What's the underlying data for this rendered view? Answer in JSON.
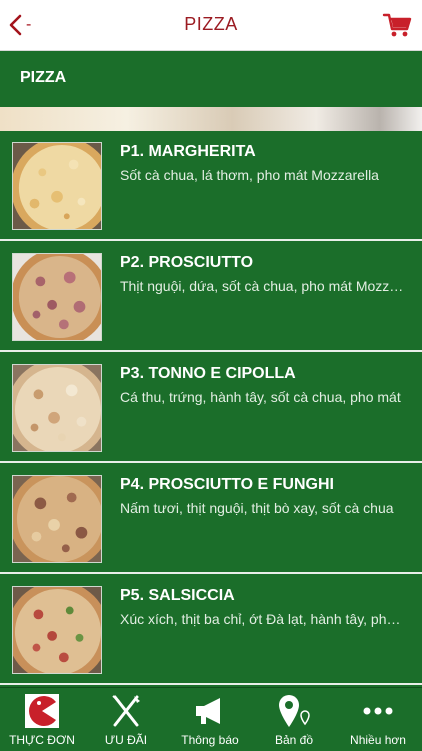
{
  "navbar": {
    "back_label": "-",
    "title": "PIZZA",
    "cart_icon": "cart-icon"
  },
  "section": {
    "title": "PIZZA"
  },
  "items": [
    {
      "title": "P1. MARGHERITA",
      "description": "Sốt cà chua, lá thơm, pho mát Mozzarella"
    },
    {
      "title": "P2. PROSCIUTTO",
      "description": "Thịt nguội, dứa, sốt cà chua, pho mát Mozzarella"
    },
    {
      "title": "P3. TONNO E CIPOLLA",
      "description": "Cá thu, trứng, hành tây, sốt cà chua, pho mát"
    },
    {
      "title": "P4. PROSCIUTTO E FUNGHI",
      "description": "Nấm tươi, thịt nguội, thịt bò xay, sốt cà chua"
    },
    {
      "title": "P5. SALSICCIA",
      "description": "Xúc xích, thịt ba chỉ, ớt Đà lạt, hành tây, pho mát"
    }
  ],
  "tabs": [
    {
      "label": "THỰC ĐƠN",
      "icon": "menu-pacman-icon"
    },
    {
      "label": "ƯU ĐÃI",
      "icon": "fork-knife-icon"
    },
    {
      "label": "Thông báo",
      "icon": "megaphone-icon"
    },
    {
      "label": "Bản đồ",
      "icon": "map-pin-icon"
    },
    {
      "label": "Nhiều hơn",
      "icon": "more-dots-icon"
    }
  ],
  "colors": {
    "brand_green": "#1b6e2a",
    "title_red": "#9b1b22",
    "accent_red": "#d0202a"
  }
}
